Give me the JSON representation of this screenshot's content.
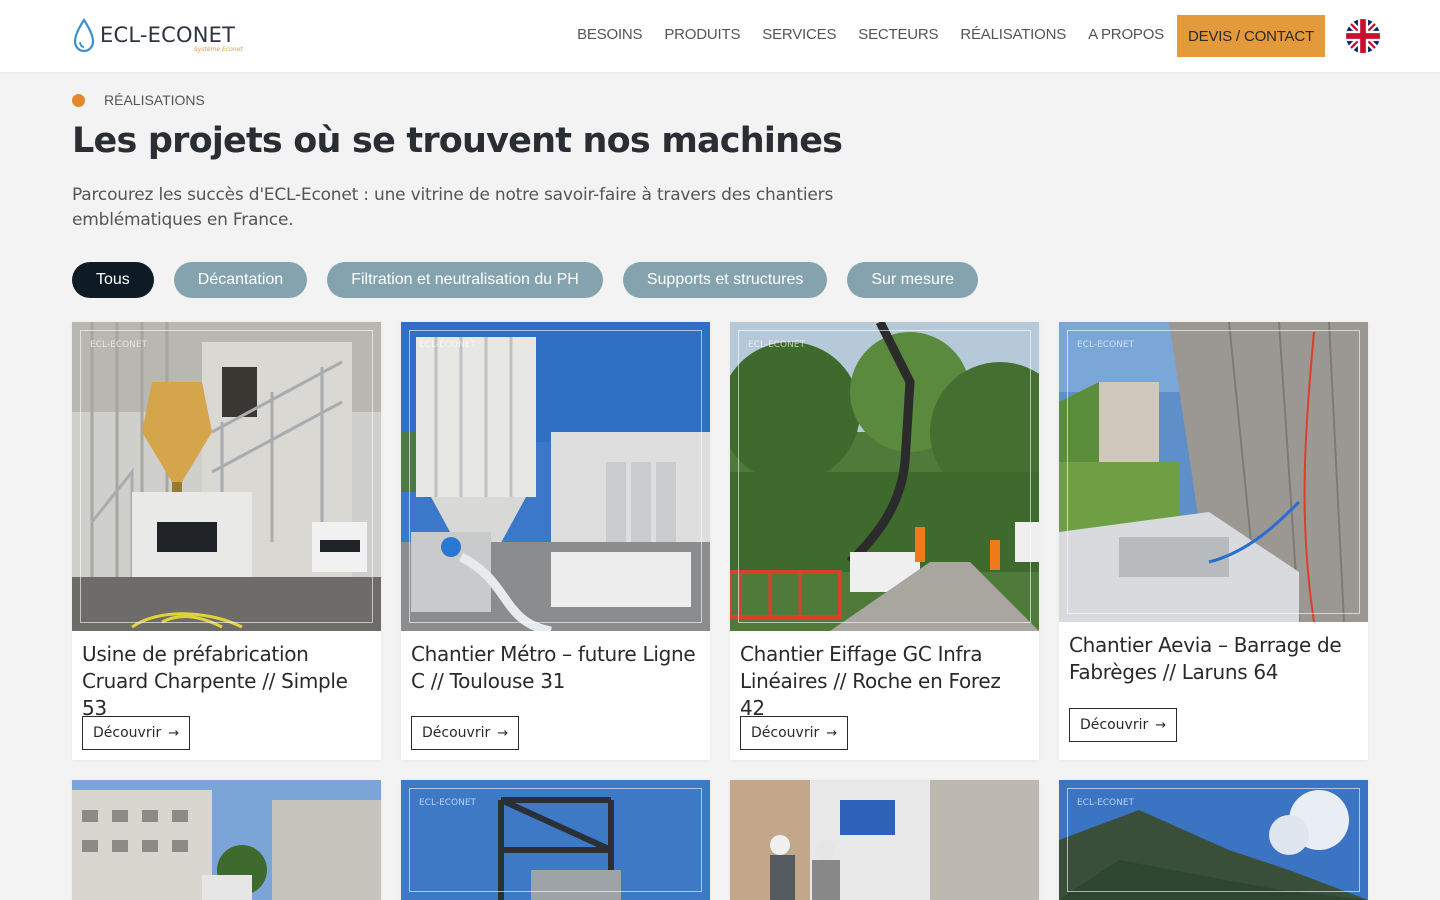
{
  "brand": {
    "name": "ECL-ECONET",
    "tagline": "Système Econet",
    "accent_color": "#e39a3b"
  },
  "nav": {
    "items": [
      {
        "label": "BESOINS"
      },
      {
        "label": "PRODUITS"
      },
      {
        "label": "SERVICES"
      },
      {
        "label": "SECTEURS"
      },
      {
        "label": "RÉALISATIONS"
      },
      {
        "label": "A PROPOS"
      }
    ],
    "cta_label": "DEVIS / CONTACT",
    "language_flag": "uk-flag-icon"
  },
  "page": {
    "eyebrow": "RÉALISATIONS",
    "title": "Les projets où se trouvent nos machines",
    "intro": "Parcourez les succès d'ECL-Econet : une vitrine de notre savoir-faire à travers des chantiers emblématiques en France."
  },
  "filters": [
    {
      "label": "Tous",
      "active": true
    },
    {
      "label": "Décantation",
      "active": false
    },
    {
      "label": "Filtration et neutralisation du PH",
      "active": false
    },
    {
      "label": "Supports et structures",
      "active": false
    },
    {
      "label": "Sur mesure",
      "active": false
    }
  ],
  "cards": [
    {
      "title": "Usine de préfabrication Cruard Charpente // Simple 53",
      "button": "Découvrir",
      "watermark": "ECL-ECONET"
    },
    {
      "title": "Chantier Métro – future Ligne C // Toulouse 31",
      "button": "Découvrir",
      "watermark": "ECL-ECONET"
    },
    {
      "title": "Chantier Eiffage GC Infra Linéaires // Roche en Forez 42",
      "button": "Découvrir",
      "watermark": "ECL-ECONET"
    },
    {
      "title": "Chantier Aevia – Barrage de Fabrèges // Laruns 64",
      "button": "Découvrir",
      "watermark": "ECL-ECONET"
    }
  ],
  "cards_row2": [
    {
      "watermark": ""
    },
    {
      "watermark": "ECL-ECONET"
    },
    {
      "watermark": ""
    },
    {
      "watermark": "ECL-ECONET"
    }
  ]
}
